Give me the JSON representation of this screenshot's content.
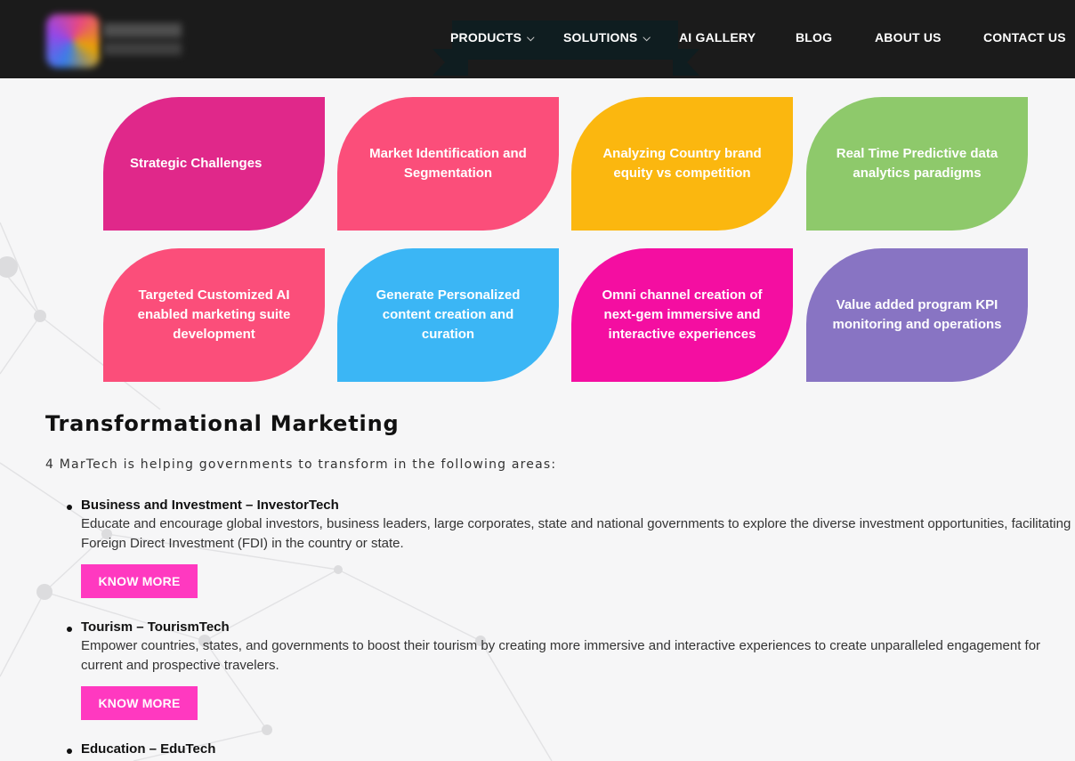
{
  "header": {
    "nav": [
      {
        "label": "PRODUCTS",
        "has_dropdown": true
      },
      {
        "label": "SOLUTIONS",
        "has_dropdown": true
      },
      {
        "label": "AI GALLERY",
        "has_dropdown": false
      },
      {
        "label": "BLOG",
        "has_dropdown": false
      },
      {
        "label": "ABOUT US",
        "has_dropdown": false
      },
      {
        "label": "CONTACT US",
        "has_dropdown": false
      }
    ],
    "chevron": "⌵"
  },
  "cards": [
    {
      "label": "Strategic Challenges",
      "color": "#e0288a"
    },
    {
      "label": "Market Identification and Segmentation",
      "color": "#fb4e7a"
    },
    {
      "label": "Analyzing Country brand equity vs competition",
      "color": "#fbb70f"
    },
    {
      "label": "Real Time Predictive data analytics paradigms",
      "color": "#8ec96b"
    },
    {
      "label": "Targeted Customized AI enabled marketing suite development",
      "color": "#fb4e7a"
    },
    {
      "label": "Generate Personalized content creation and curation",
      "color": "#3bb6f5"
    },
    {
      "label": "Omni channel creation of next-gem immersive and interactive experiences",
      "color": "#f40ea1"
    },
    {
      "label": "Value added program KPI monitoring and operations",
      "color": "#8874c3"
    }
  ],
  "section": {
    "title": "Transformational Marketing",
    "intro": "4 MarTech is helping governments to transform in the following areas:",
    "areas": [
      {
        "title": "Business and Investment – InvestorTech",
        "description": "Educate and encourage global investors, business leaders, large corporates, state and national governments to explore the diverse investment opportunities, facilitating Foreign Direct Investment (FDI) in the country or state.",
        "button": "KNOW MORE"
      },
      {
        "title": "Tourism – TourismTech",
        "description": "Empower countries, states, and governments to boost their tourism by creating more immersive and interactive experiences to create unparalleled engagement for current and prospective travelers.",
        "button": "KNOW MORE"
      },
      {
        "title": "Education – EduTech",
        "description": "",
        "button": ""
      }
    ]
  },
  "colors": {
    "header_bg": "#1b1b1b",
    "accent_button": "#ff39c0",
    "page_bg": "#f6f6f7"
  }
}
